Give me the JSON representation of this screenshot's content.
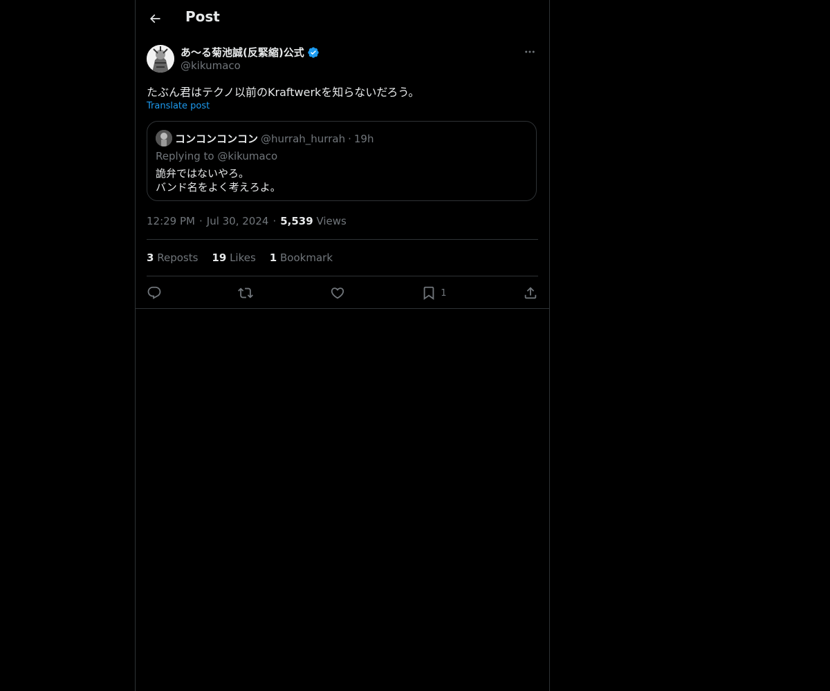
{
  "header": {
    "title": "Post"
  },
  "author": {
    "name": "あ〜る菊池誠(反緊縮)公式",
    "handle": "@kikumaco"
  },
  "post": {
    "text": "たぶん君はテクノ以前のKraftwerkを知らないだろう。",
    "translate_label": "Translate post"
  },
  "quote": {
    "name": "コンコンコンコン",
    "handle": "@hurrah_hurrah",
    "separator": "·",
    "time": "19h",
    "replying_to": "Replying to @kikumaco",
    "lines": [
      "詭弁ではないやろ。",
      "バンド名をよく考えろよ。"
    ]
  },
  "meta": {
    "time": "12:29 PM",
    "separator": "·",
    "date": "Jul 30, 2024",
    "views_count": "5,539",
    "views_label": "Views"
  },
  "stats": {
    "reposts_count": "3",
    "reposts_label": "Reposts",
    "likes_count": "19",
    "likes_label": "Likes",
    "bookmarks_count": "1",
    "bookmarks_label": "Bookmark"
  },
  "actions": {
    "bookmark_count": "1",
    "icons": [
      "reply-icon",
      "repost-icon",
      "like-icon",
      "bookmark-icon",
      "share-icon"
    ]
  },
  "colors": {
    "background": "#000000",
    "text": "#e7e9ea",
    "muted": "#71767b",
    "border": "#2f3336",
    "accent": "#1d9bf0"
  }
}
